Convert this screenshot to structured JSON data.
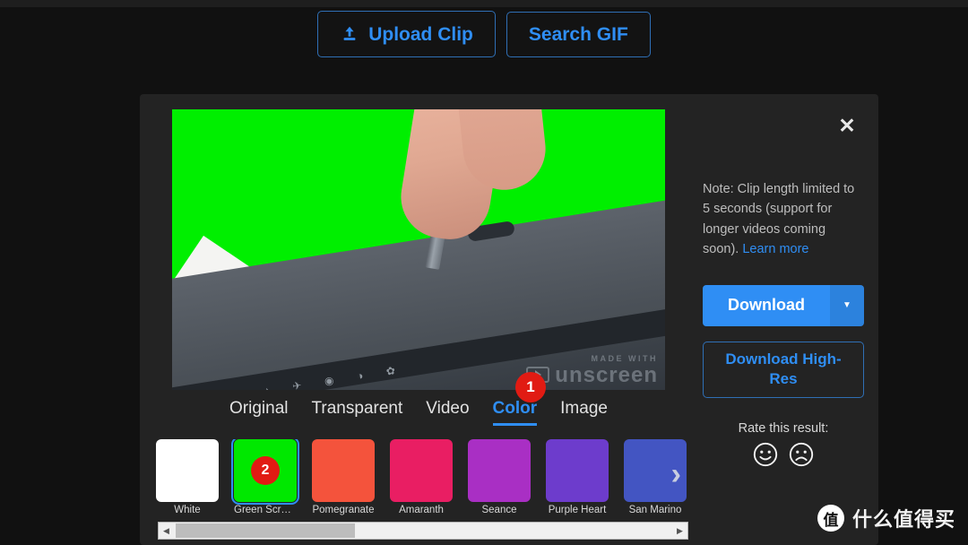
{
  "topbar": {
    "upload_label": "Upload Clip",
    "upload_icon": "upload-icon",
    "search_label": "Search GIF"
  },
  "panel": {
    "close_icon": "✕",
    "preview": {
      "watermark_made": "MADE WITH",
      "watermark_name": "unscreen"
    },
    "badges": {
      "badge_one": "1",
      "badge_two": "2"
    },
    "tabs": [
      {
        "label": "Original",
        "active": false
      },
      {
        "label": "Transparent",
        "active": false
      },
      {
        "label": "Video",
        "active": false
      },
      {
        "label": "Color",
        "active": true
      },
      {
        "label": "Image",
        "active": false
      }
    ],
    "swatches": [
      {
        "label": "White",
        "color": "#ffffff",
        "selected": false
      },
      {
        "label": "Green Screen",
        "color": "#00e800",
        "selected": true
      },
      {
        "label": "Pomegranate",
        "color": "#f4533c",
        "selected": false
      },
      {
        "label": "Amaranth",
        "color": "#e91e63",
        "selected": false
      },
      {
        "label": "Seance",
        "color": "#a92fc4",
        "selected": false
      },
      {
        "label": "Purple Heart",
        "color": "#6d3ccc",
        "selected": false
      },
      {
        "label": "San Marino",
        "color": "#4355c2",
        "selected": false
      }
    ],
    "swatch_next_icon": "›",
    "scrollbar": {
      "left_arrow": "◀",
      "right_arrow": "▶"
    }
  },
  "side": {
    "note_text": "Note: Clip length limited to 5 seconds (support for longer videos coming soon). ",
    "note_link": "Learn more",
    "download_label": "Download",
    "download_caret_icon": "▼",
    "download_hires_label": "Download High-Res",
    "rate_label": "Rate this result:",
    "rate_happy_icon": "happy-face-icon",
    "rate_sad_icon": "sad-face-icon"
  },
  "site_watermark": {
    "logo_char": "值",
    "text": "什么值得买"
  },
  "colors": {
    "accent": "#2f8ef4",
    "badge": "#e11b13",
    "panel_bg": "#232323",
    "page_bg": "#111111"
  }
}
